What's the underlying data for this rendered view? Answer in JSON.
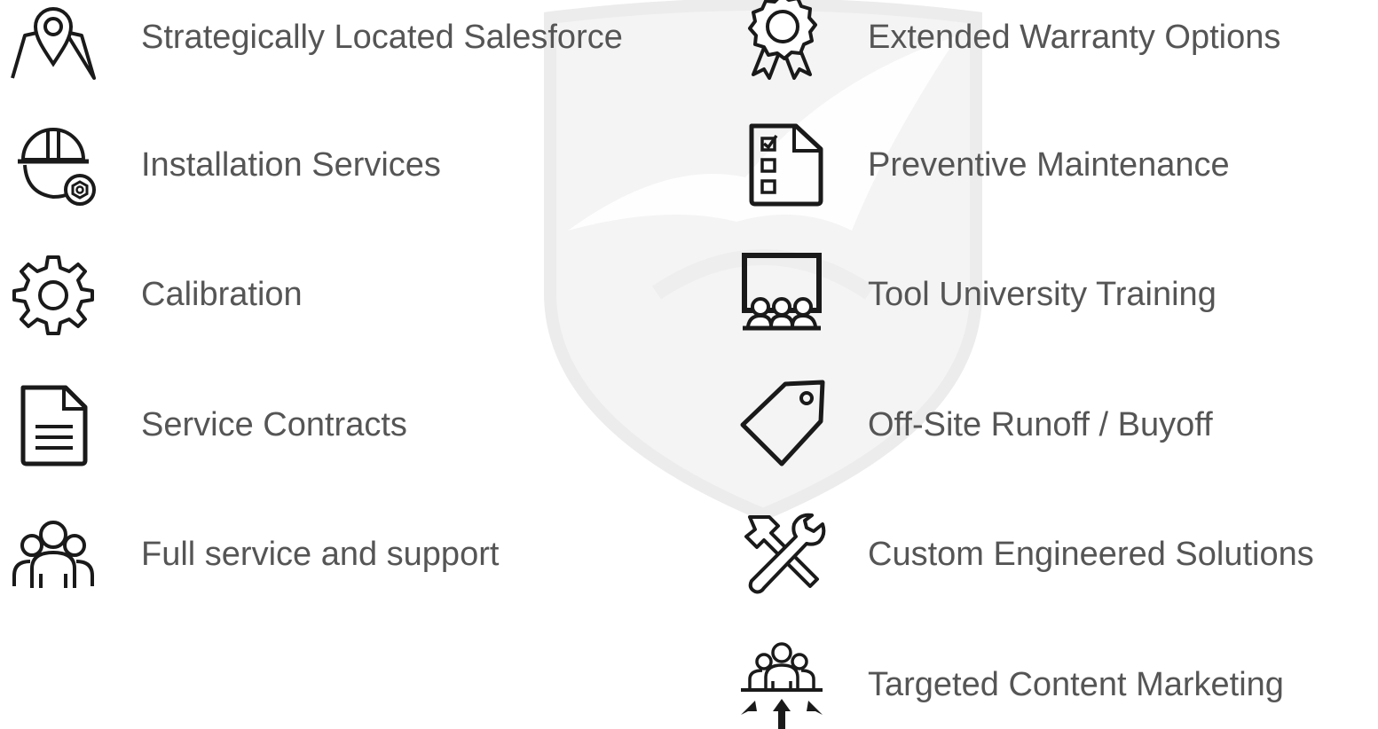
{
  "left_column": {
    "items": [
      {
        "label": "Strategically Located Salesforce",
        "icon": "map-location-pin-icon"
      },
      {
        "label": "Installation Services",
        "icon": "hardhat-worker-nut-icon"
      },
      {
        "label": "Calibration",
        "icon": "gear-icon"
      },
      {
        "label": "Service Contracts",
        "icon": "document-icon"
      },
      {
        "label": "Full service and support",
        "icon": "people-group-icon"
      }
    ]
  },
  "right_column": {
    "items": [
      {
        "label": "Extended Warranty Options",
        "icon": "award-ribbon-icon"
      },
      {
        "label": "Preventive Maintenance",
        "icon": "checklist-document-icon"
      },
      {
        "label": "Tool University Training",
        "icon": "classroom-icon"
      },
      {
        "label": "Off-Site Runoff / Buyoff",
        "icon": "price-tag-icon"
      },
      {
        "label": "Custom Engineered Solutions",
        "icon": "hammer-wrench-icon"
      },
      {
        "label": "Targeted Content Marketing",
        "icon": "target-audience-icon"
      }
    ]
  },
  "colors": {
    "text": "#555555",
    "icon": "#1a1a1a",
    "watermark": "#f2f2f2"
  }
}
